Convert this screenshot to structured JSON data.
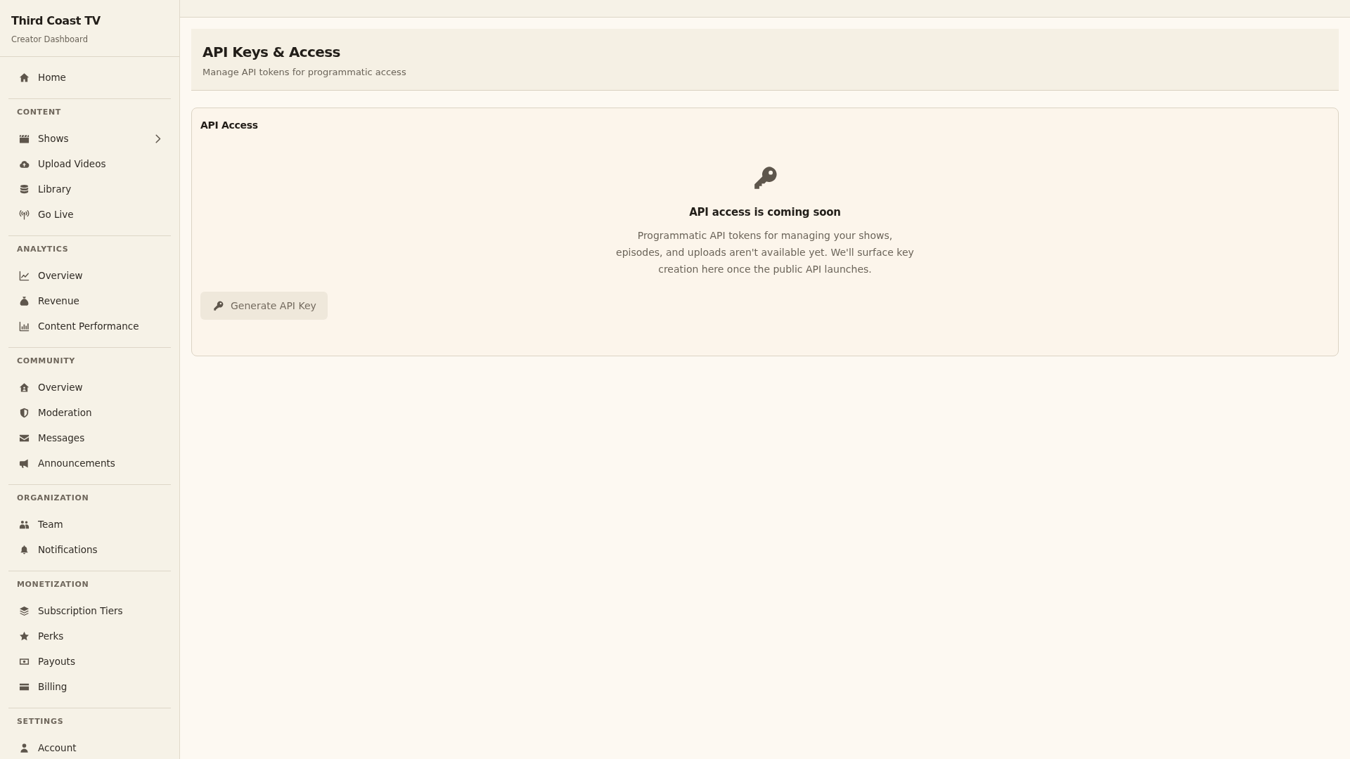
{
  "sidebar": {
    "brand": {
      "title": "Third Coast TV",
      "subtitle": "Creator Dashboard"
    },
    "sections": [
      {
        "items": [
          {
            "label": "Home",
            "selected": false
          }
        ]
      },
      {
        "heading": "CONTENT",
        "items": [
          {
            "label": "Shows",
            "selected": false,
            "expanded": false
          },
          {
            "label": "Upload Videos",
            "selected": false
          },
          {
            "label": "Library",
            "selected": false
          },
          {
            "label": "Go Live",
            "selected": false
          }
        ]
      },
      {
        "heading": "ANALYTICS",
        "items": [
          {
            "label": "Overview",
            "selected": false
          },
          {
            "label": "Revenue",
            "selected": false
          },
          {
            "label": "Content Performance",
            "selected": false
          }
        ]
      },
      {
        "heading": "COMMUNITY",
        "items": [
          {
            "label": "Overview",
            "selected": false
          },
          {
            "label": "Moderation",
            "selected": false
          },
          {
            "label": "Messages",
            "selected": false
          },
          {
            "label": "Announcements",
            "selected": false
          }
        ]
      },
      {
        "heading": "ORGANIZATION",
        "items": [
          {
            "label": "Team",
            "selected": false
          },
          {
            "label": "Notifications",
            "selected": false
          }
        ]
      },
      {
        "heading": "MONETIZATION",
        "items": [
          {
            "label": "Subscription Tiers",
            "selected": false
          },
          {
            "label": "Perks",
            "selected": false
          },
          {
            "label": "Payouts",
            "selected": false
          },
          {
            "label": "Billing",
            "selected": false
          }
        ]
      },
      {
        "heading": "SETTINGS",
        "items": [
          {
            "label": "Account",
            "selected": false
          }
        ]
      }
    ]
  },
  "page_header": {
    "title": "API Keys & Access",
    "subtitle": "Manage API tokens for programmatic access"
  },
  "card": {
    "title": "API Access",
    "empty_state": {
      "heading": "API access is coming soon",
      "text": "Programmatic API tokens for managing your shows, episodes, and uploads aren't available yet. We'll surface key creation here once the public API launches."
    },
    "button": {
      "label": "Generate API Key",
      "disabled": true
    }
  }
}
